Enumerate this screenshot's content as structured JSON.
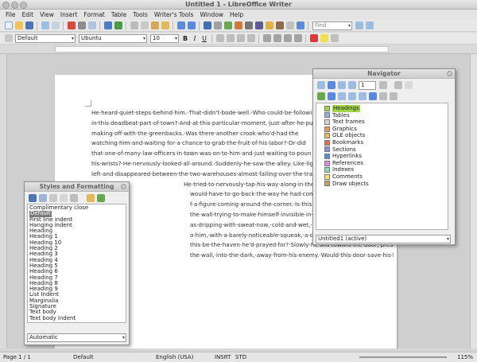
{
  "window": {
    "title": "Untitled 1 - LibreOffice Writer"
  },
  "menu": [
    "File",
    "Edit",
    "View",
    "Insert",
    "Format",
    "Table",
    "Tools",
    "Writer's Tools",
    "Window",
    "Help"
  ],
  "formatting": {
    "paragraph_style": "Default",
    "font_name": "Ubuntu",
    "font_size": "10",
    "bold_label": "B",
    "italic_label": "I",
    "underline_label": "U"
  },
  "find": {
    "placeholder": "Find"
  },
  "document": {
    "lines": [
      "He·heard·quiet·steps·behind·him.·That·didn't·bode·well.·Who·could·be·followin",
      "in·this·deadbeat·part·of·town?·And·at·this·particular·moment,·just·after·he·pull",
      "making·off·with·the·greenbacks.·Was·there·another·crook·who'd·had·the",
      "watching·him·and·waiting·for·a·chance·to·grab·the·fruit·of·his·labor?·Or·did",
      "that·one·of·many·law·officers·in·town·was·on·to·him·and·just·waiting·to·poun",
      "his·wrists?·He·nervously·looked·all·around.·Suddenly·he·saw·the·alley.·Like·lig",
      "left·and·disappeared·between·the·two·warehouses·almost·falling·over·the·tras",
      "He·tried·to·nervously·tap·his·way·along·in·the·inky·darkness·and",
      "would·have·to·go·back·the·way·he·had·come.·The·steps·got·lou",
      "f·a·figure·coming·around·the·corner.·Is·this·the·end·of·the·line?·He",
      "the·wall·trying·to·make·himself·invisible·in·the·dark,·was·all",
      "as·dripping·with·sweat·now,·cold·and·wet,·he·could·smell·the·f",
      "o·him,·with·a·barely·noticeable·squeak,·a·door·swung·quiet",
      "this·be·the·haven·he'd·prayed·for?·Slowly·he·slid·toward·the·door,·pressing·himself·more",
      "the·wall,·into·the·dark,·away·from·his·enemy.·Would·this·door·save·his·hide?¶"
    ]
  },
  "styles_panel": {
    "title": "Styles and Formatting",
    "items": [
      "Complimentary close",
      "Default",
      "First line indent",
      "Hanging indent",
      "Heading",
      "Heading 1",
      "Heading 10",
      "Heading 2",
      "Heading 3",
      "Heading 4",
      "Heading 5",
      "Heading 6",
      "Heading 7",
      "Heading 8",
      "Heading 9",
      "List Indent",
      "Marginalia",
      "Signature",
      "Text body",
      "Text body indent"
    ],
    "selected": "Default",
    "filter": "Automatic"
  },
  "navigator": {
    "title": "Navigator",
    "spin_value": "1",
    "items": [
      {
        "label": "Headings",
        "color": "#9fd64a"
      },
      {
        "label": "Tables",
        "color": "#8fb4e3"
      },
      {
        "label": "Text frames",
        "color": "#d9d9d9"
      },
      {
        "label": "Graphics",
        "color": "#e39b55"
      },
      {
        "label": "OLE objects",
        "color": "#e3c255"
      },
      {
        "label": "Bookmarks",
        "color": "#e36d55"
      },
      {
        "label": "Sections",
        "color": "#8f8fd9"
      },
      {
        "label": "Hyperlinks",
        "color": "#5a8fd9"
      },
      {
        "label": "References",
        "color": "#d98fd9"
      },
      {
        "label": "Indexes",
        "color": "#8fd9b4"
      },
      {
        "label": "Comments",
        "color": "#f2e36d"
      },
      {
        "label": "Draw objects",
        "color": "#c9a06d"
      }
    ],
    "document_selector": "Untitled1 (active)"
  },
  "status": {
    "page": "Page 1 / 1",
    "style": "Default",
    "language": "English (USA)",
    "insert": "INSRT",
    "selection": "STD",
    "zoom": "115%"
  }
}
